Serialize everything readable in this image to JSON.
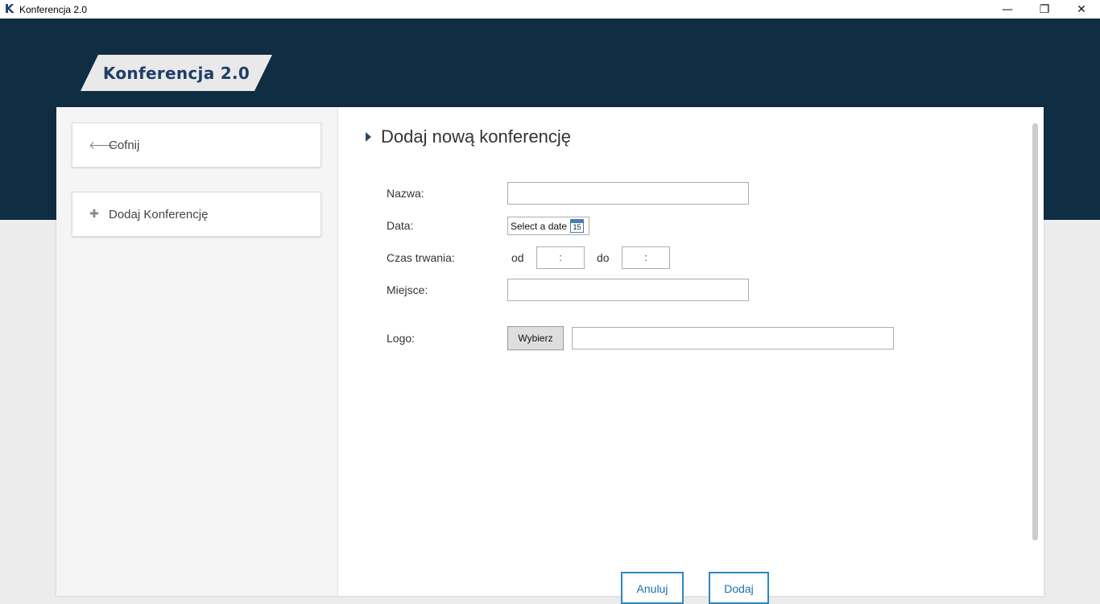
{
  "window": {
    "app_icon_letter": "K",
    "title": "Konferencja 2.0",
    "minimize_glyph": "—",
    "restore_glyph": "❐",
    "close_glyph": "✕"
  },
  "header": {
    "logo_text": "Konferencja 2.0",
    "band_color": "#0f2d43"
  },
  "sidebar": {
    "items": [
      {
        "icon": "arrow-left-icon",
        "glyph": "🡐",
        "label": "Cofnij"
      },
      {
        "icon": "plus-icon",
        "glyph": "✚",
        "label": "Dodaj Konferencję"
      }
    ]
  },
  "main": {
    "heading": "Dodaj nową konferencję",
    "form": {
      "name_label": "Nazwa:",
      "name_value": "",
      "date_label": "Data:",
      "date_placeholder": "Select a date",
      "calendar_day": "15",
      "duration_label": "Czas trwania:",
      "from_label": "od",
      "from_time": ":",
      "to_label": "do",
      "to_time": ":",
      "place_label": "Miejsce:",
      "place_value": "",
      "logo_label": "Logo:",
      "choose_button": "Wybierz",
      "logo_path": ""
    },
    "buttons": {
      "cancel": "Anuluj",
      "add": "Dodaj"
    }
  },
  "colors": {
    "accent": "#2e86c1",
    "heading_caret": "#2a4a6c"
  }
}
